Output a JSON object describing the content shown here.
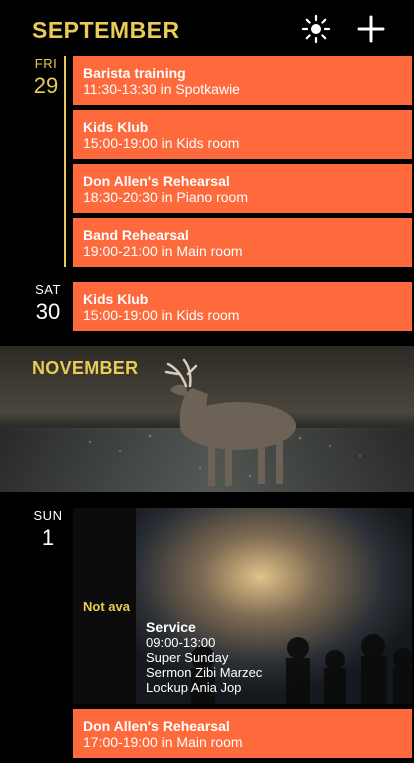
{
  "september": {
    "title": "SEPTEMBER",
    "days": [
      {
        "dow": "FRI",
        "day": "29",
        "events": [
          {
            "title": "Barista training",
            "time": "11:30-13:30 in Spotkawie"
          },
          {
            "title": "Kids Klub",
            "time": "15:00-19:00 in Kids room"
          },
          {
            "title": "Don Allen's Rehearsal",
            "time": "18:30-20:30 in Piano room"
          },
          {
            "title": "Band Rehearsal",
            "time": "19:00-21:00 in Main room"
          }
        ]
      },
      {
        "dow": "SAT",
        "day": "30",
        "events": [
          {
            "title": "Kids Klub",
            "time": "15:00-19:00 in Kids room"
          }
        ]
      }
    ]
  },
  "header_icons": {
    "settings_icon": "sun-icon",
    "add_icon": "plus-icon"
  },
  "november": {
    "title": "NOVEMBER",
    "days": [
      {
        "dow": "SUN",
        "day": "1",
        "service": {
          "status": "Not ava",
          "title": "Service",
          "time": "09:00-13:00",
          "line1": "Super Sunday",
          "line2": "Sermon Zibi Marzec",
          "line3": "Lockup Ania Jop"
        },
        "events": [
          {
            "title": "Don Allen's Rehearsal",
            "time": "17:00-19:00 in Main room"
          }
        ]
      }
    ]
  },
  "colors": {
    "accent": "#e8cc55",
    "event": "#fe6a3c",
    "background": "#000000"
  }
}
